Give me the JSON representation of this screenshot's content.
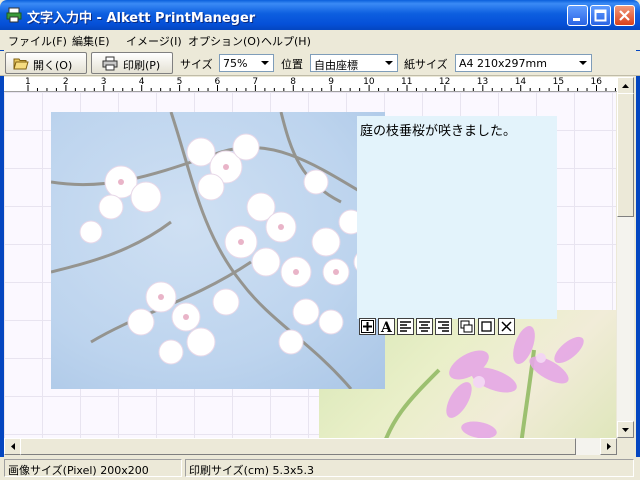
{
  "window": {
    "title": "文字入力中 - Alkett PrintManeger"
  },
  "menu": {
    "items": [
      {
        "label": "ファイル(F)"
      },
      {
        "label": "編集(E)"
      },
      {
        "label": "イメージ(I)"
      },
      {
        "label": "オプション(O)"
      },
      {
        "label": "ヘルプ(H)"
      }
    ]
  },
  "toolbar": {
    "open_label": "開く(O)",
    "print_label": "印刷(P)",
    "size_label": "サイズ",
    "size_value": "75%",
    "position_label": "位置",
    "position_value": "自由座標",
    "paper_label": "紙サイズ",
    "paper_value": "A4 210x297mm"
  },
  "ruler": {
    "ticks": [
      "1",
      "2",
      "3",
      "4",
      "5",
      "6",
      "7",
      "8",
      "9",
      "10",
      "11",
      "12",
      "13",
      "14",
      "15",
      "16"
    ]
  },
  "canvas": {
    "text": "庭の枝垂桜が咲きました。"
  },
  "status": {
    "image_size": "画像サイズ(Pixel) 200x200",
    "print_size": "印刷サイズ(cm) 5.3x5.3"
  },
  "colors": {
    "titlebar": "#0550d8",
    "text_box_bg": "#e3f3fb",
    "canvas_bg": "#fbf8ff"
  }
}
